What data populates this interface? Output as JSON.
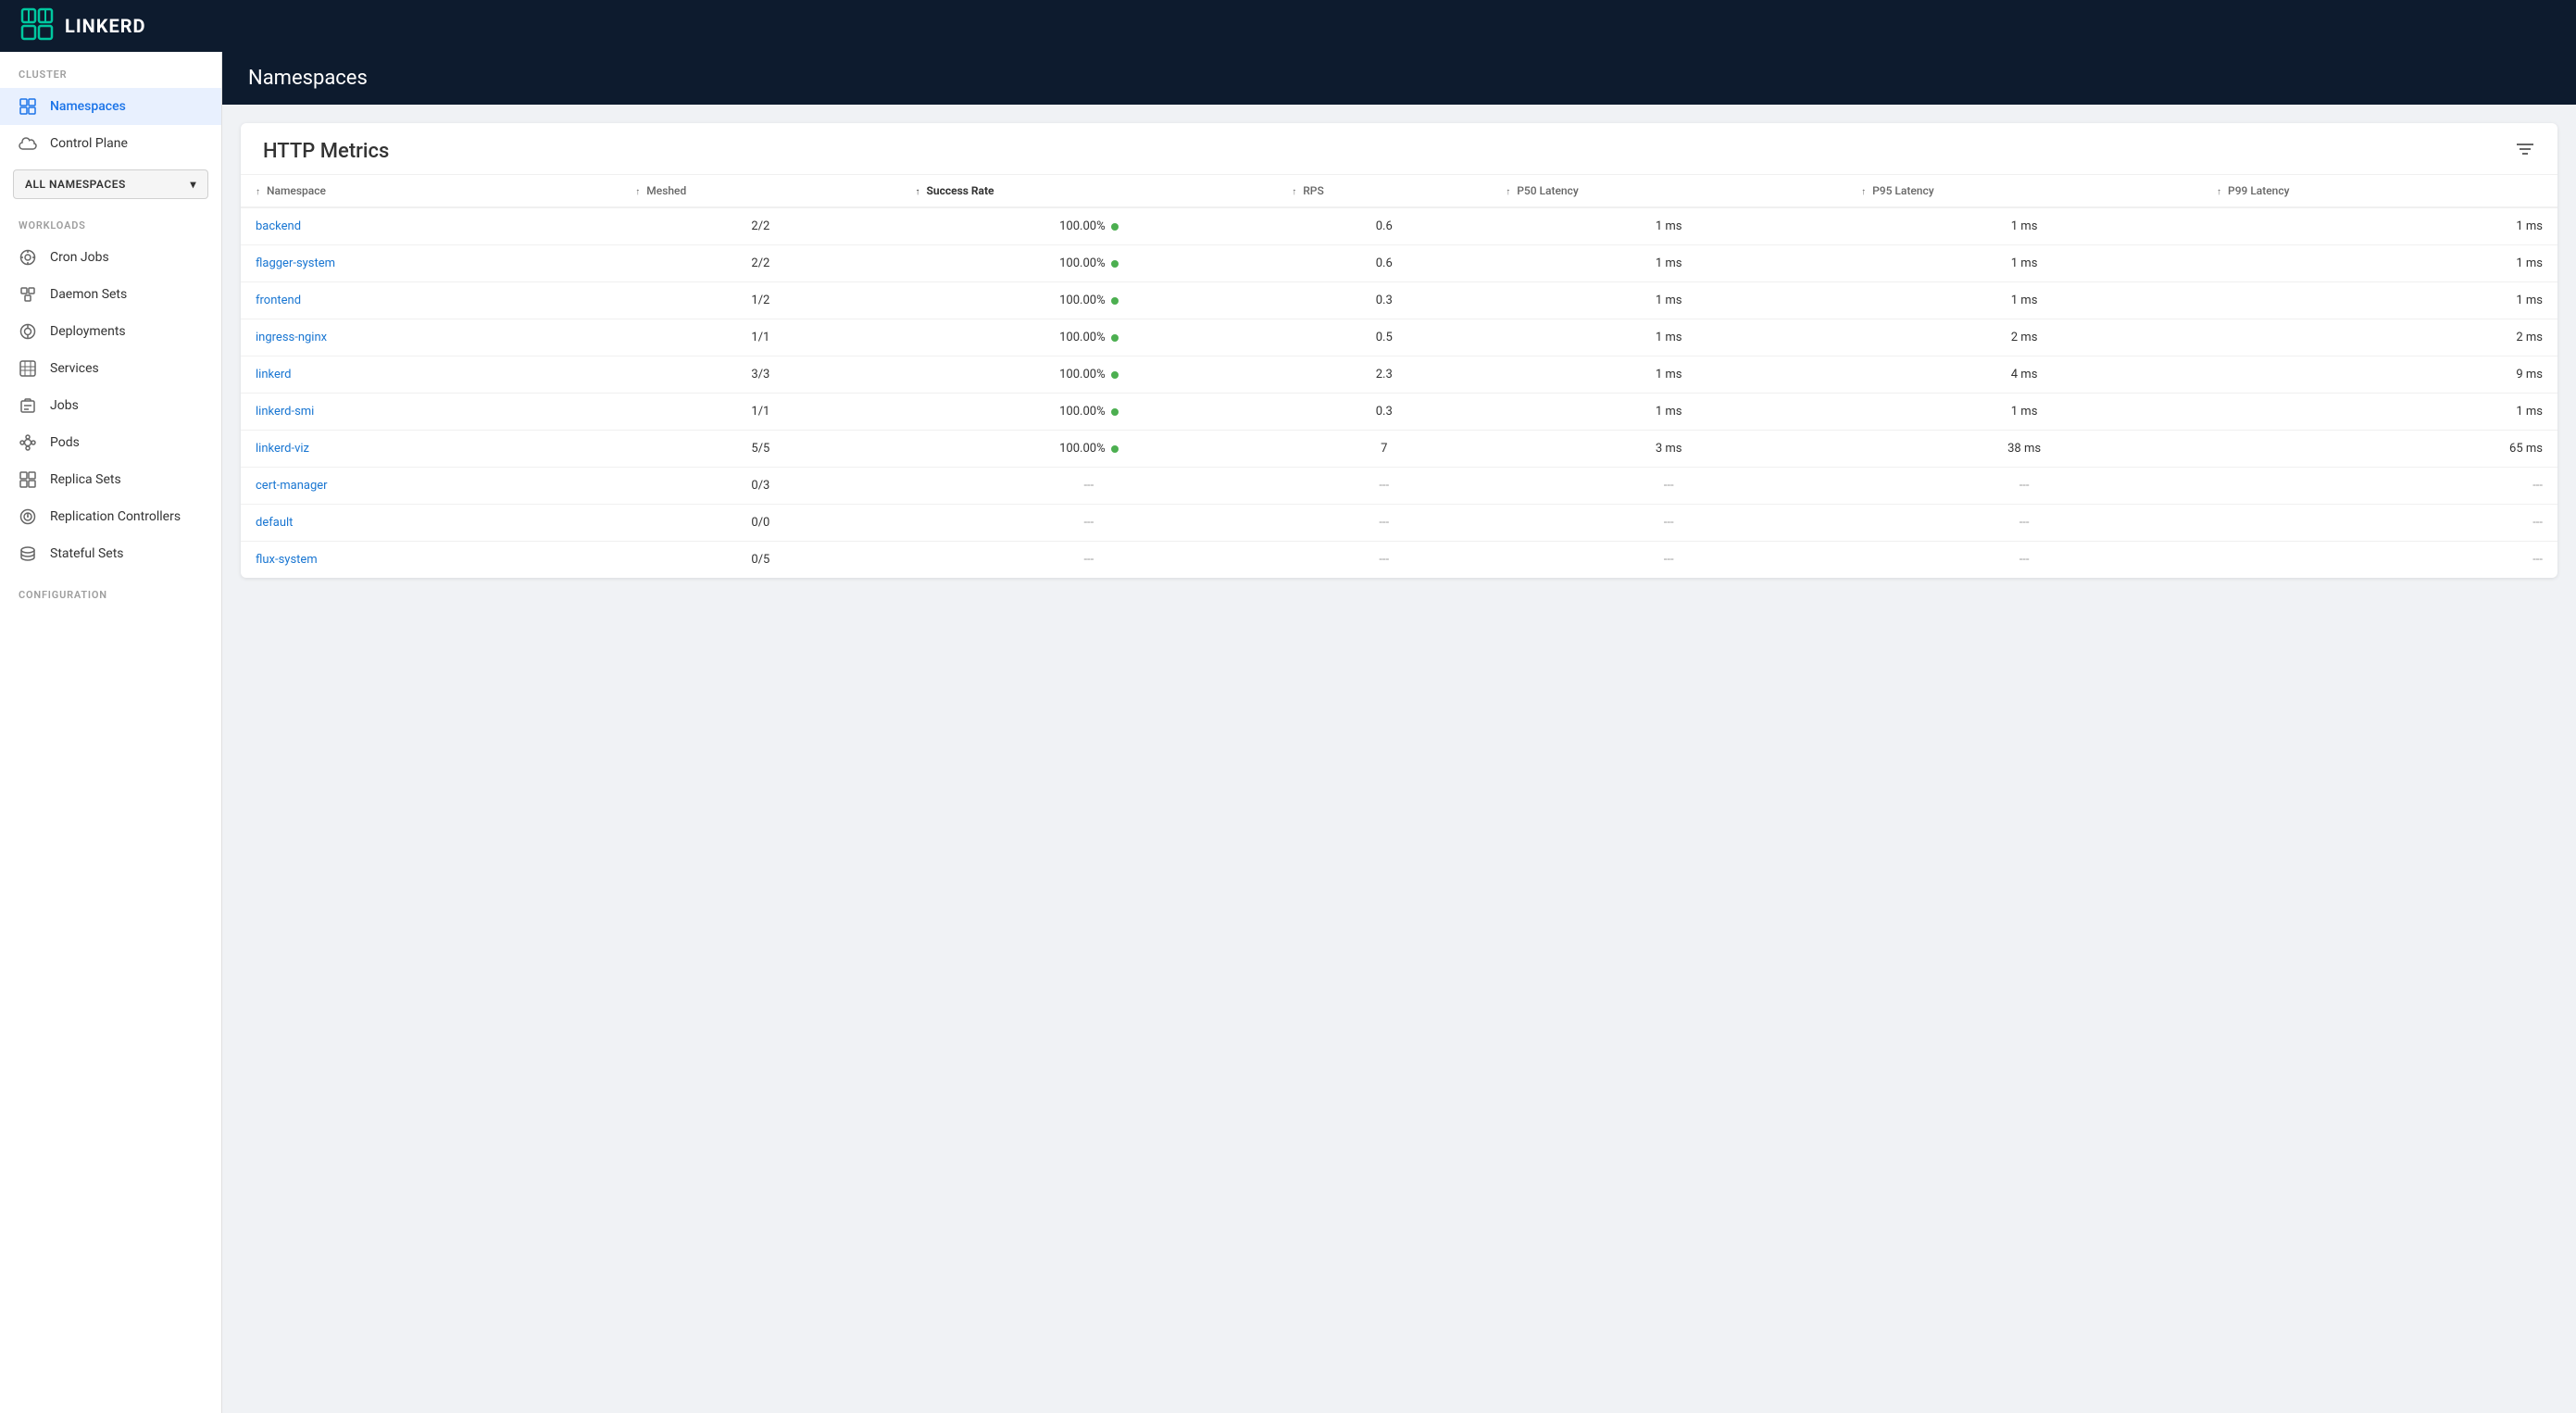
{
  "app": {
    "logo_text": "LINKERD"
  },
  "page_header": {
    "title": "Namespaces"
  },
  "sidebar": {
    "cluster_section_label": "CLUSTER",
    "workloads_section_label": "WORKLOADS",
    "configuration_section_label": "CONFIGURATION",
    "cluster_items": [
      {
        "id": "namespaces",
        "label": "Namespaces",
        "icon": "grid-icon",
        "active": true
      },
      {
        "id": "control-plane",
        "label": "Control Plane",
        "icon": "cloud-icon",
        "active": false
      }
    ],
    "workload_items": [
      {
        "id": "cron-jobs",
        "label": "Cron Jobs",
        "icon": "cron-icon"
      },
      {
        "id": "daemon-sets",
        "label": "Daemon Sets",
        "icon": "daemon-icon"
      },
      {
        "id": "deployments",
        "label": "Deployments",
        "icon": "deploy-icon"
      },
      {
        "id": "services",
        "label": "Services",
        "icon": "service-icon"
      },
      {
        "id": "jobs",
        "label": "Jobs",
        "icon": "jobs-icon"
      },
      {
        "id": "pods",
        "label": "Pods",
        "icon": "pods-icon"
      },
      {
        "id": "replica-sets",
        "label": "Replica Sets",
        "icon": "replica-icon"
      },
      {
        "id": "replication-controllers",
        "label": "Replication Controllers",
        "icon": "repcontrol-icon"
      },
      {
        "id": "stateful-sets",
        "label": "Stateful Sets",
        "icon": "stateful-icon"
      }
    ],
    "namespace_dropdown": {
      "label": "ALL NAMESPACES"
    }
  },
  "metrics": {
    "title": "HTTP Metrics",
    "columns": [
      {
        "id": "namespace",
        "label": "Namespace",
        "sortable": true,
        "active": false
      },
      {
        "id": "meshed",
        "label": "Meshed",
        "sortable": true,
        "active": false
      },
      {
        "id": "success-rate",
        "label": "Success Rate",
        "sortable": true,
        "active": true
      },
      {
        "id": "rps",
        "label": "RPS",
        "sortable": true,
        "active": false
      },
      {
        "id": "p50",
        "label": "P50 Latency",
        "sortable": true,
        "active": false
      },
      {
        "id": "p95",
        "label": "P95 Latency",
        "sortable": true,
        "active": false
      },
      {
        "id": "p99",
        "label": "P99 Latency",
        "sortable": true,
        "active": false
      }
    ],
    "rows": [
      {
        "namespace": "backend",
        "meshed": "2/2",
        "success_rate": "100.00%",
        "success_dot": true,
        "rps": "0.6",
        "p50": "1 ms",
        "p95": "1 ms",
        "p99": "1 ms"
      },
      {
        "namespace": "flagger-system",
        "meshed": "2/2",
        "success_rate": "100.00%",
        "success_dot": true,
        "rps": "0.6",
        "p50": "1 ms",
        "p95": "1 ms",
        "p99": "1 ms"
      },
      {
        "namespace": "frontend",
        "meshed": "1/2",
        "success_rate": "100.00%",
        "success_dot": true,
        "rps": "0.3",
        "p50": "1 ms",
        "p95": "1 ms",
        "p99": "1 ms"
      },
      {
        "namespace": "ingress-nginx",
        "meshed": "1/1",
        "success_rate": "100.00%",
        "success_dot": true,
        "rps": "0.5",
        "p50": "1 ms",
        "p95": "2 ms",
        "p99": "2 ms"
      },
      {
        "namespace": "linkerd",
        "meshed": "3/3",
        "success_rate": "100.00%",
        "success_dot": true,
        "rps": "2.3",
        "p50": "1 ms",
        "p95": "4 ms",
        "p99": "9 ms"
      },
      {
        "namespace": "linkerd-smi",
        "meshed": "1/1",
        "success_rate": "100.00%",
        "success_dot": true,
        "rps": "0.3",
        "p50": "1 ms",
        "p95": "1 ms",
        "p99": "1 ms"
      },
      {
        "namespace": "linkerd-viz",
        "meshed": "5/5",
        "success_rate": "100.00%",
        "success_dot": true,
        "rps": "7",
        "p50": "3 ms",
        "p95": "38 ms",
        "p99": "65 ms"
      },
      {
        "namespace": "cert-manager",
        "meshed": "0/3",
        "success_rate": "---",
        "success_dot": false,
        "rps": "---",
        "p50": "---",
        "p95": "---",
        "p99": "---"
      },
      {
        "namespace": "default",
        "meshed": "0/0",
        "success_rate": "---",
        "success_dot": false,
        "rps": "---",
        "p50": "---",
        "p95": "---",
        "p99": "---"
      },
      {
        "namespace": "flux-system",
        "meshed": "0/5",
        "success_rate": "---",
        "success_dot": false,
        "rps": "---",
        "p50": "---",
        "p95": "---",
        "p99": "---"
      }
    ]
  }
}
